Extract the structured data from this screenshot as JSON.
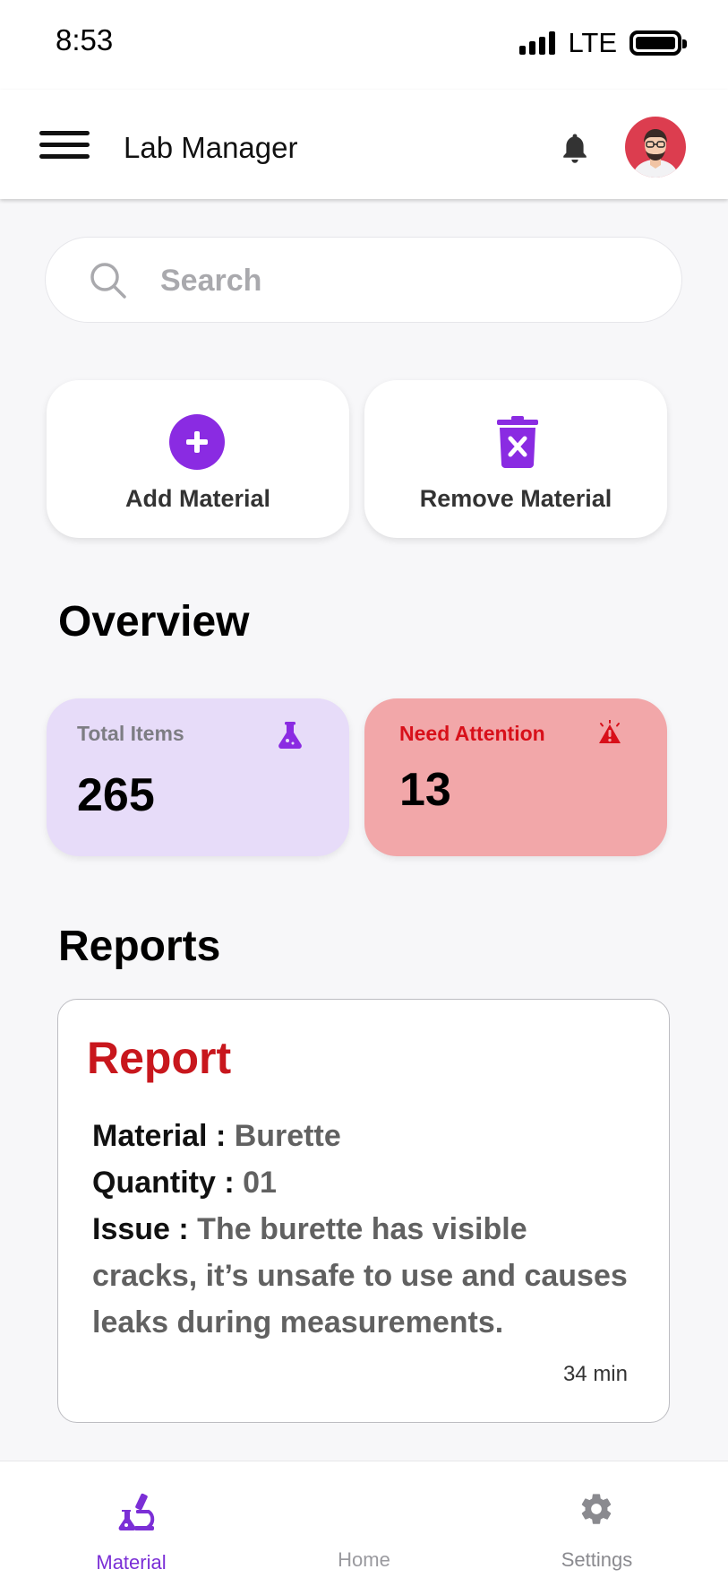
{
  "status_bar": {
    "time": "8:53",
    "network": "LTE"
  },
  "app_bar": {
    "title": "Lab Manager",
    "menu_icon": "hamburger-menu-icon",
    "bell_icon": "bell-icon"
  },
  "search": {
    "placeholder": "Search",
    "value": ""
  },
  "actions": [
    {
      "label": "Add Material",
      "icon": "add-circle-icon"
    },
    {
      "label": "Remove Material",
      "icon": "trash-x-icon"
    }
  ],
  "overview": {
    "title": "Overview",
    "total": {
      "label": "Total Items",
      "value": "265",
      "icon": "flask-icon"
    },
    "attention": {
      "label": "Need Attention",
      "value": "13",
      "icon": "siren-icon"
    }
  },
  "reports": {
    "title": "Reports",
    "card": {
      "title": "Report",
      "material_key": "Material :",
      "material_value": "Burette",
      "quantity_key": "Quantity :",
      "quantity_value": "01",
      "issue_key": "Issue :",
      "issue_value": "The burette has visible cracks, it’s unsafe to use and causes leaks during measurements.",
      "time": "34 min"
    }
  },
  "bottom_nav": [
    {
      "label": "Material",
      "icon": "microscope-icon",
      "active": true
    },
    {
      "label": "Home",
      "active": false
    },
    {
      "label": "Settings",
      "icon": "gear-icon",
      "active": false
    }
  ],
  "colors": {
    "accent": "#8a2be2",
    "alert_red": "#c8171d",
    "total_card": "#e7dcf9",
    "attention_card": "#f2a7a9"
  }
}
